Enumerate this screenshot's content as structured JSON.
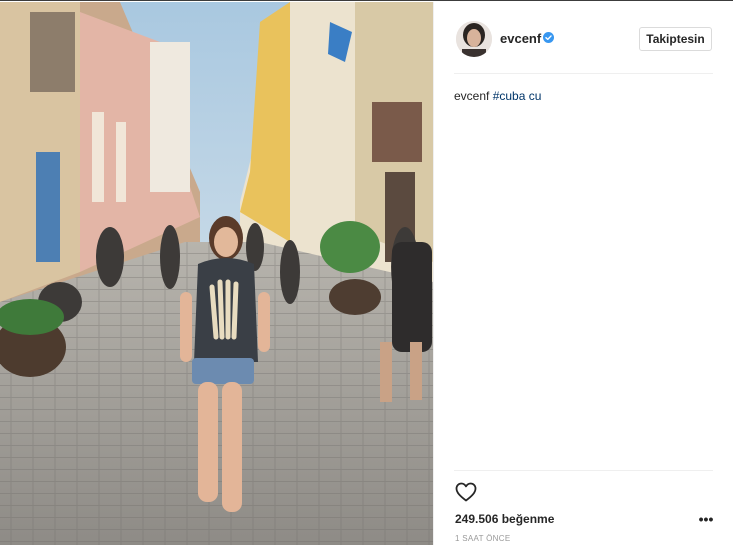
{
  "post": {
    "username": "evcenf",
    "verified": true,
    "follow_label": "Takiptesin",
    "caption_user": "evcenf",
    "caption_text": "#cuba cu",
    "likes_text": "249.506 beğenme",
    "time_text": "1 SAAT ÖNCE",
    "more_label": "•••"
  },
  "icons": {
    "verified": "verified-badge-icon",
    "heart": "heart-outline-icon",
    "more": "more-options-icon"
  },
  "colors": {
    "verified": "#3897f0",
    "hashtag": "#003569",
    "timestamp": "#999999",
    "divider": "#efefef"
  }
}
